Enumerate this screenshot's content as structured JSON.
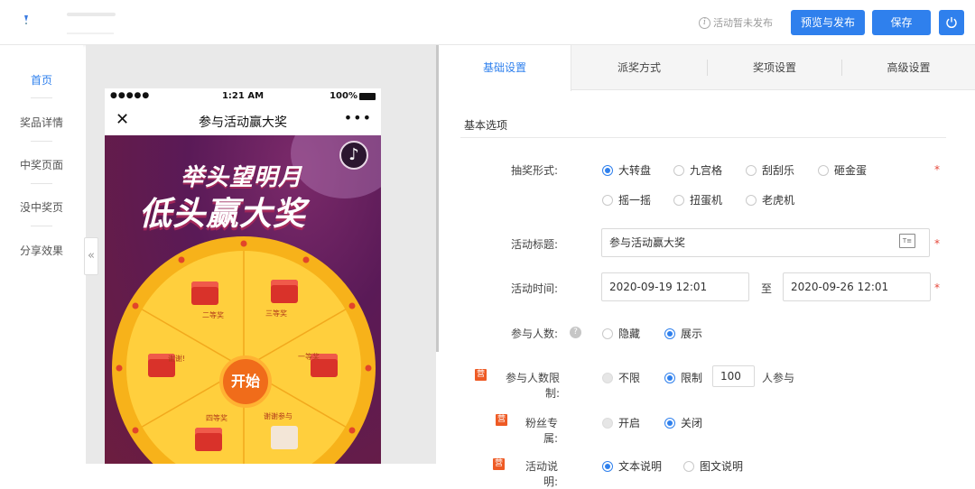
{
  "header": {
    "status_text": "活动暂未发布",
    "preview_publish_label": "预览与发布",
    "save_label": "保存"
  },
  "leftnav": {
    "items": [
      {
        "label": "首页",
        "active": true
      },
      {
        "label": "奖品详情",
        "active": false
      },
      {
        "label": "中奖页面",
        "active": false
      },
      {
        "label": "没中奖页",
        "active": false
      },
      {
        "label": "分享效果",
        "active": false
      }
    ],
    "collapse_glyph": "«"
  },
  "phone": {
    "signal": "●●●●●",
    "time": "1:21 AM",
    "battery": "100%",
    "close_glyph": "✕",
    "title": "参与活动赢大奖",
    "more_glyph": "•••",
    "headline_line1": "举头望明月",
    "headline_line2": "低头赢大奖",
    "start_label": "开始",
    "prizes": [
      "一等奖",
      "二等奖",
      "三等奖",
      "四等奖",
      "谢谢参与",
      "谢谢!"
    ]
  },
  "tabs": [
    {
      "label": "基础设置",
      "active": true
    },
    {
      "label": "派奖方式",
      "active": false
    },
    {
      "label": "奖项设置",
      "active": false
    },
    {
      "label": "高级设置",
      "active": false
    }
  ],
  "form": {
    "section_title": "基本选项",
    "draw_type_label": "抽奖形式:",
    "draw_types": [
      {
        "label": "大转盘",
        "selected": true
      },
      {
        "label": "九宫格",
        "selected": false
      },
      {
        "label": "刮刮乐",
        "selected": false
      },
      {
        "label": "砸金蛋",
        "selected": false
      },
      {
        "label": "摇一摇",
        "selected": false
      },
      {
        "label": "扭蛋机",
        "selected": false
      },
      {
        "label": "老虎机",
        "selected": false
      }
    ],
    "title_label": "活动标题:",
    "title_value": "参与活动赢大奖",
    "time_label": "活动时间:",
    "start_time": "2020-09-19 12:01",
    "time_sep": "至",
    "end_time": "2020-09-26 12:01",
    "participants_label": "参与人数:",
    "participants_hide": "隐藏",
    "participants_show": "展示",
    "limit_label": "参与人数限制:",
    "limit_none": "不限",
    "limit_limited": "限制",
    "limit_value": "100",
    "limit_suffix": "人参与",
    "fans_label": "粉丝专属:",
    "fans_on": "开启",
    "fans_off": "关闭",
    "tag_glyph": "营",
    "desc_label": "活动说明:",
    "desc_text": "文本说明",
    "desc_image": "图文说明",
    "required_glyph": "*",
    "help_glyph": "?"
  },
  "colors": {
    "accent": "#2f80ed",
    "required": "#e5483a",
    "tag": "#ee5a24"
  }
}
